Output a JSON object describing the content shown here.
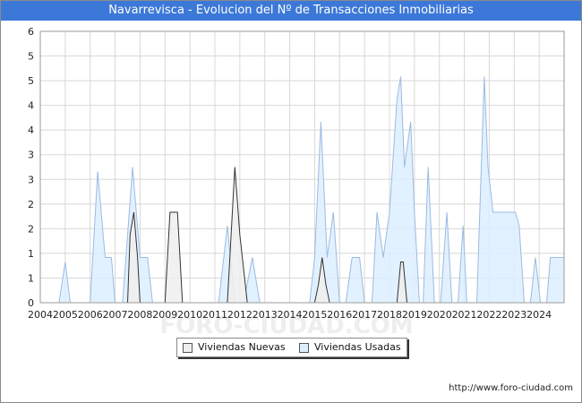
{
  "title": "Navarrevisca - Evolucion del Nº de Transacciones Inmobiliarias",
  "source_text": "http://www.foro-ciudad.com",
  "watermark": "FORO-CIUDAD.COM",
  "colors": {
    "title_bg": "#3c78d8",
    "nuevas_fill": "#eeeeee",
    "nuevas_line": "#333333",
    "usadas_fill": "#ddeeff",
    "usadas_line": "#9bbbe3",
    "grid": "#d8d8d8"
  },
  "chart_data": {
    "type": "area",
    "title": "Navarrevisca - Evolucion del Nº de Transacciones Inmobiliarias",
    "xlabel": "",
    "ylabel": "",
    "xlim": [
      2004,
      2025
    ],
    "ylim": [
      0,
      6
    ],
    "x_ticks": [
      "2004",
      "2005",
      "2006",
      "2007",
      "2008",
      "2009",
      "2010",
      "2011",
      "2012",
      "2013",
      "2014",
      "2015",
      "2016",
      "2017",
      "2018",
      "2019",
      "2020",
      "2021",
      "2022",
      "2023",
      "2024"
    ],
    "y_ticks": [
      "0",
      "1",
      "1",
      "2",
      "2",
      "3",
      "3",
      "4",
      "4",
      "5",
      "5",
      "6"
    ],
    "grid": true,
    "legend_position": "bottom",
    "series": [
      {
        "name": "Viviendas Nuevas",
        "x": [
          2004.0,
          2007.5,
          2007.6,
          2007.75,
          2007.9,
          2008.0,
          2009.0,
          2009.2,
          2009.35,
          2009.5,
          2009.7,
          2010.0,
          2011.5,
          2011.6,
          2011.8,
          2012.0,
          2012.1,
          2012.3,
          2013.0,
          2015.0,
          2015.15,
          2015.3,
          2015.45,
          2015.6,
          2018.0,
          2018.3,
          2018.45,
          2018.55,
          2018.7,
          2019.0,
          2025.0
        ],
        "y": [
          0,
          0,
          1.5,
          2.0,
          1.0,
          0,
          0,
          2.0,
          2.0,
          2.0,
          0,
          0,
          0,
          1.0,
          3.0,
          1.5,
          1.0,
          0,
          0,
          0,
          0.4,
          1.0,
          0.4,
          0,
          0,
          0,
          0.9,
          0.9,
          0,
          0,
          0
        ]
      },
      {
        "name": "Viviendas Usadas",
        "x": [
          2004.0,
          2004.75,
          2005.0,
          2005.2,
          2005.8,
          2006.0,
          2006.3,
          2006.6,
          2006.85,
          2007.0,
          2007.3,
          2007.7,
          2008.0,
          2008.3,
          2008.5,
          2011.0,
          2011.15,
          2011.5,
          2011.8,
          2012.0,
          2012.15,
          2012.5,
          2012.8,
          2014.5,
          2014.8,
          2015.0,
          2015.25,
          2015.5,
          2015.75,
          2016.0,
          2016.25,
          2016.5,
          2016.8,
          2017.0,
          2017.3,
          2017.5,
          2017.75,
          2018.0,
          2018.3,
          2018.45,
          2018.6,
          2018.85,
          2019.0,
          2019.2,
          2019.35,
          2019.55,
          2019.8,
          2020.05,
          2020.3,
          2020.5,
          2020.75,
          2020.95,
          2021.1,
          2021.3,
          2021.5,
          2021.8,
          2021.95,
          2022.15,
          2022.35,
          2022.55,
          2023.05,
          2023.2,
          2023.4,
          2023.65,
          2023.85,
          2024.05,
          2024.3,
          2024.45,
          2024.6,
          2025.0
        ],
        "y": [
          0,
          0,
          0.9,
          0,
          0,
          0,
          2.9,
          1.0,
          1.0,
          0,
          0,
          3.0,
          1.0,
          1.0,
          0,
          0,
          0,
          1.7,
          0,
          0,
          0,
          1.0,
          0,
          0,
          0,
          1.0,
          4.0,
          1.0,
          2.0,
          0,
          0,
          1.0,
          1.0,
          0,
          0,
          2.0,
          1.0,
          2.0,
          4.5,
          5.0,
          3.0,
          4.0,
          2.0,
          0,
          0,
          3.0,
          0,
          0,
          2.0,
          0,
          0,
          1.7,
          0,
          0,
          0,
          5.0,
          3.0,
          2.0,
          2.0,
          2.0,
          2.0,
          1.7,
          0,
          0,
          1.0,
          0,
          0,
          1.0,
          1.0,
          1.0
        ]
      }
    ]
  }
}
